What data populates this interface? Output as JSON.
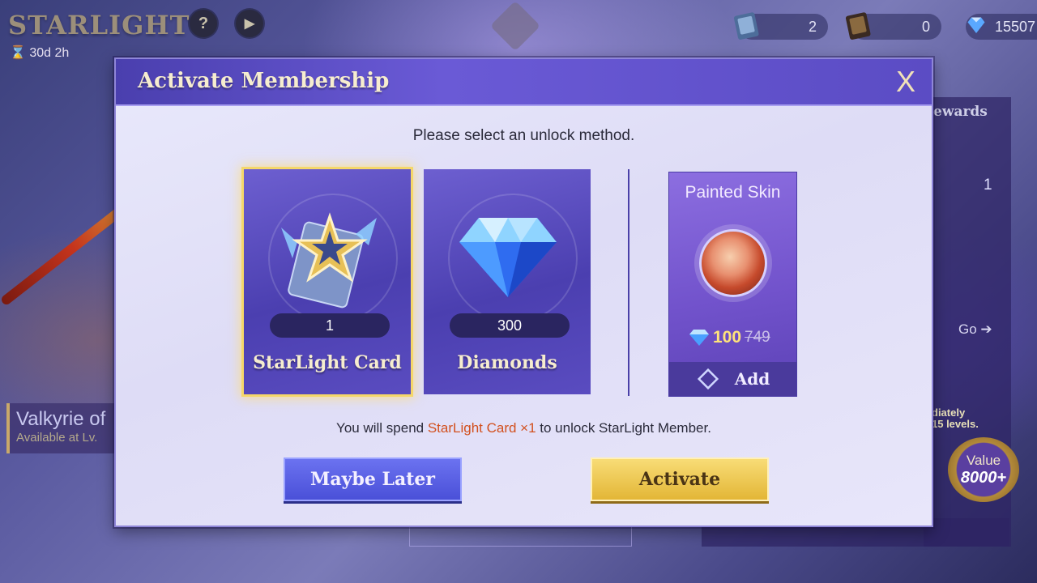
{
  "background": {
    "title": "STARLIGHT",
    "timer": "30d  2h",
    "help_icon": "question-icon",
    "play_icon": "play-icon",
    "resources": [
      {
        "name": "ticket-icon",
        "value": "2"
      },
      {
        "name": "dark-ticket-icon",
        "value": "0"
      },
      {
        "name": "diamond-icon",
        "value": "15507"
      }
    ],
    "side_event_title": "Valkyrie of",
    "side_event_sub": "Available at Lv.",
    "rewards_label": "ewards",
    "reward_count": "1",
    "go_label": "Go",
    "right_small_text_1": "diately",
    "right_small_text_2": "15 levels.",
    "value_label": "Value",
    "value_amount": "8000+"
  },
  "modal": {
    "title": "Activate Membership",
    "close_label": "X",
    "prompt": "Please select an unlock method.",
    "options": [
      {
        "label": "StarLight Card",
        "qty": "1",
        "selected": true
      },
      {
        "label": "Diamonds",
        "qty": "300",
        "selected": false
      }
    ],
    "skin": {
      "title": "Painted Skin",
      "price_now": "100",
      "price_was": "749",
      "add_label": "Add"
    },
    "spend_prefix": "You will spend ",
    "spend_highlight": "StarLight Card ×1",
    "spend_suffix": " to unlock StarLight Member.",
    "maybe_later_label": "Maybe Later",
    "activate_label": "Activate"
  },
  "colors": {
    "accent_gold": "#f5d76a",
    "header_purple": "#5b4cc4",
    "highlight_orange": "#d2501e"
  }
}
